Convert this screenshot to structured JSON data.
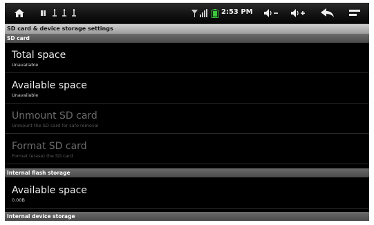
{
  "status_bar": {
    "time": "2:53 PM",
    "icons": [
      "home-icon",
      "notification-icons",
      "usb-icon",
      "signal-icon",
      "battery-icon",
      "volume-down-icon",
      "volume-up-icon",
      "back-icon",
      "menu-icon"
    ]
  },
  "header": {
    "title": "SD card & device storage settings"
  },
  "sections": {
    "sd_card": {
      "label": "SD card",
      "items": [
        {
          "title": "Total space",
          "subtitle": "Unavailable"
        },
        {
          "title": "Available space",
          "subtitle": "Unavailable"
        },
        {
          "title": "Unmount SD card",
          "subtitle": "Unmount the SD card for safe removal"
        },
        {
          "title": "Format SD card",
          "subtitle": "Format (erase) the SD card"
        }
      ]
    },
    "internal_flash": {
      "label": "Internal flash storage",
      "items": [
        {
          "title": "Available space",
          "subtitle": "0.00B"
        }
      ]
    },
    "internal_device": {
      "label": "Internal device storage"
    }
  },
  "colors": {
    "background": "#000000",
    "section_header": "#5a5a5a",
    "title_bar": "#b5b5b5",
    "disabled_text": "#6a6a6a",
    "battery_green": "#3cc63c"
  }
}
